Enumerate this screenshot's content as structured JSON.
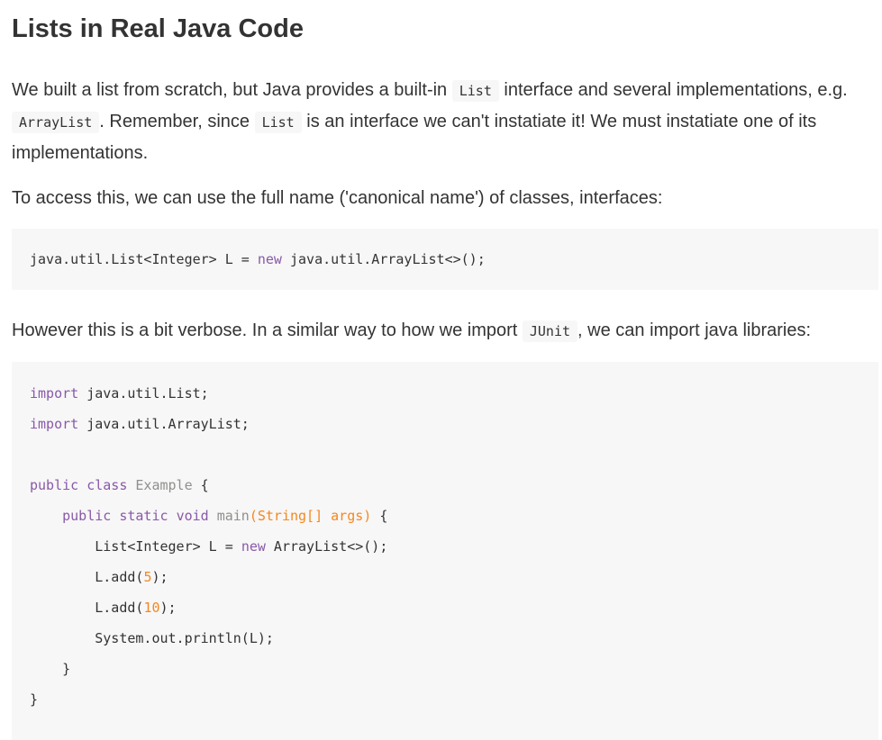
{
  "heading": "Lists in Real Java Code",
  "para1": {
    "t1": "We built a list from scratch, but Java provides a built-in ",
    "c1": "List",
    "t2": " interface and several implementations, e.g. ",
    "c2": "ArrayList",
    "t3": ". Remember, since ",
    "c3": "List",
    "t4": " is an interface we can't instatiate it! We must instatiate one of its implementations."
  },
  "para2": "To access this, we can use the full name ('canonical name') of classes, interfaces:",
  "code1": {
    "a": "java.util.List<Integer> L = ",
    "kw": "new",
    "b": " java.util.ArrayList<>();"
  },
  "para3": {
    "t1": "However this is a bit verbose. In a similar way to how we import ",
    "c1": "JUnit",
    "t2": ", we can import java libraries:"
  },
  "code2": {
    "l1_kw": "import",
    "l1_rest": " java.util.List;",
    "l2_kw": "import",
    "l2_rest": " java.util.ArrayList;",
    "l4_kw1": "public",
    "l4_kw2": "class",
    "l4_cls": "Example",
    "l4_rest": " {",
    "l5_indent": "    ",
    "l5_kw1": "public",
    "l5_kw2": "static",
    "l5_kw3": "void",
    "l5_fn": "main",
    "l5_params": "(String[] args)",
    "l5_rest": " {",
    "l6_a": "        List<Integer> L = ",
    "l6_kw": "new",
    "l6_b": " ArrayList<>();",
    "l7_a": "        L.add(",
    "l7_num": "5",
    "l7_b": ");",
    "l8_a": "        L.add(",
    "l8_num": "10",
    "l8_b": ");",
    "l9": "        System.out.println(L);",
    "l10": "    }",
    "l11": "}"
  }
}
